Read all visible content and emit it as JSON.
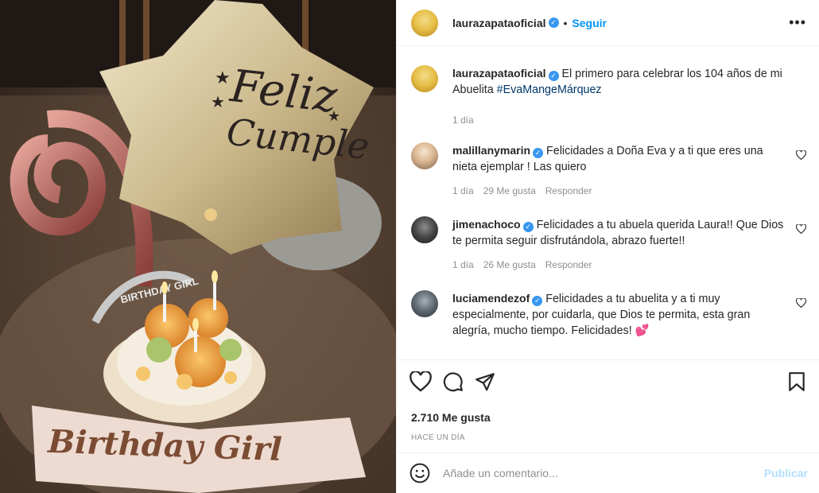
{
  "post": {
    "author": "laurazapataoficial",
    "follow_label": "Seguir",
    "separator": "•",
    "more_label": "•••",
    "caption": {
      "username": "laurazapataoficial",
      "text": "El primero para celebrar los 104 años de mi Abuelita ",
      "hashtag": "#EvaMangeMárquez",
      "time": "1 día"
    },
    "balloon_text_1": "Feliz",
    "balloon_text_2": "Cumple",
    "sash_text": "Birthday Girl",
    "tiara_text": "BIRTHDAY GIRL"
  },
  "comments": [
    {
      "username": "malillanymarin",
      "text": "Felicidades a Doña Eva y a ti que eres una nieta ejemplar ! Las quiero",
      "time": "1 día",
      "likes": "29 Me gusta",
      "reply": "Responder"
    },
    {
      "username": "jimenachoco",
      "text": "Felicidades a tu abuela querida Laura!! Que Dios te permita seguir disfrutándola, abrazo fuerte!!",
      "time": "1 día",
      "likes": "26 Me gusta",
      "reply": "Responder"
    },
    {
      "username": "luciamendezof",
      "text": "Felicidades a tu abuelita y a ti muy especialmente, por cuidarla, que Dios te permita, esta gran alegría, mucho tiempo. Felicidades! ",
      "emoji": "💕"
    }
  ],
  "actions": {
    "likes": "2.710 Me gusta",
    "when": "HACE UN DÍA"
  },
  "add_comment": {
    "placeholder": "Añade un comentario...",
    "publish": "Publicar"
  },
  "colors": {
    "accent": "#0095f6",
    "verified": "#3897f0",
    "publish_disabled": "#b2dffc",
    "muted": "#8e8e8e"
  }
}
